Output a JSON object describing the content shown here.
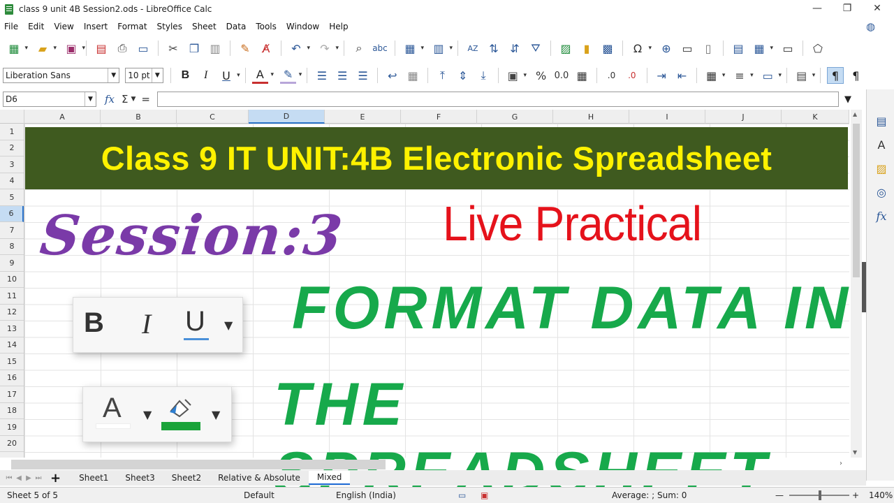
{
  "window": {
    "title": "class 9 unit 4B Session2.ods - LibreOffice Calc",
    "minimize": "—",
    "maximize": "❐",
    "close": "✕"
  },
  "menu": [
    "File",
    "Edit",
    "View",
    "Insert",
    "Format",
    "Styles",
    "Sheet",
    "Data",
    "Tools",
    "Window",
    "Help"
  ],
  "toolbar": {
    "font_name": "Liberation Sans",
    "font_size": "10 pt",
    "bold": "B",
    "italic": "I",
    "underline": "U",
    "percent": "%",
    "decimal": "0.0",
    "pilcrow": "¶"
  },
  "formula_bar": {
    "name_box": "D6",
    "fx": "fx",
    "sigma": "Σ",
    "equals": "=",
    "content": ""
  },
  "columns": [
    "A",
    "B",
    "C",
    "D",
    "E",
    "F",
    "G",
    "H",
    "I",
    "J",
    "K"
  ],
  "rows": [
    "1",
    "2",
    "3",
    "4",
    "5",
    "6",
    "7",
    "8",
    "9",
    "10",
    "11",
    "12",
    "13",
    "14",
    "15",
    "16",
    "17",
    "18",
    "19",
    "20"
  ],
  "active_cell": {
    "column": "D",
    "row": "6"
  },
  "content": {
    "banner": "Class 9 IT UNIT:4B Electronic Spreadsheet",
    "session": "Session:3",
    "live": "Live Practical",
    "line1": "FORMAT DATA IN",
    "line2": "THE SPREADSHEET",
    "biu": {
      "b": "B",
      "i": "I",
      "u": "U"
    },
    "font_color_letter": "A"
  },
  "sheet_tabs": [
    "Sheet1",
    "Sheet3",
    "Sheet2",
    "Relative & Absolute",
    "Mixed"
  ],
  "active_tab": "Mixed",
  "add_tab": "+",
  "status": {
    "sheet": "Sheet 5 of 5",
    "style": "Default",
    "language": "English (India)",
    "summary": "Average: ; Sum: 0",
    "zoom_minus": "—",
    "zoom_plus": "+",
    "zoom": "140%"
  },
  "colors": {
    "banner_bg": "#3f5a1f",
    "banner_text": "#fff200",
    "session": "#7a3aa8",
    "live": "#e5121b",
    "format": "#17a94b"
  }
}
